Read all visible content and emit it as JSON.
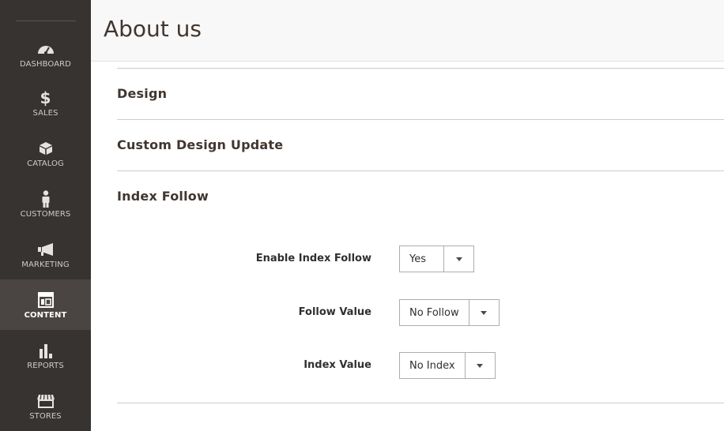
{
  "sidebar": {
    "items": [
      {
        "label": "DASHBOARD",
        "icon": "dashboard-icon"
      },
      {
        "label": "SALES",
        "icon": "dollar-icon"
      },
      {
        "label": "CATALOG",
        "icon": "box-icon"
      },
      {
        "label": "CUSTOMERS",
        "icon": "person-icon"
      },
      {
        "label": "MARKETING",
        "icon": "megaphone-icon"
      },
      {
        "label": "CONTENT",
        "icon": "layout-icon",
        "active": true
      },
      {
        "label": "REPORTS",
        "icon": "bar-chart-icon"
      },
      {
        "label": "STORES",
        "icon": "store-icon"
      }
    ],
    "sales_symbol": "$"
  },
  "header": {
    "title": "About us"
  },
  "sections": [
    {
      "title": "Design"
    },
    {
      "title": "Custom Design Update"
    },
    {
      "title": "Index Follow"
    }
  ],
  "form": {
    "enable_index_follow": {
      "label": "Enable Index Follow",
      "value": "Yes"
    },
    "follow_value": {
      "label": "Follow Value",
      "value": "No Follow"
    },
    "index_value": {
      "label": "Index Value",
      "value": "No Index"
    }
  },
  "colors": {
    "sidebar_bg": "#373330",
    "sidebar_active_bg": "#4a4542",
    "header_bg": "#f8f8f8",
    "title_color": "#41362f"
  }
}
